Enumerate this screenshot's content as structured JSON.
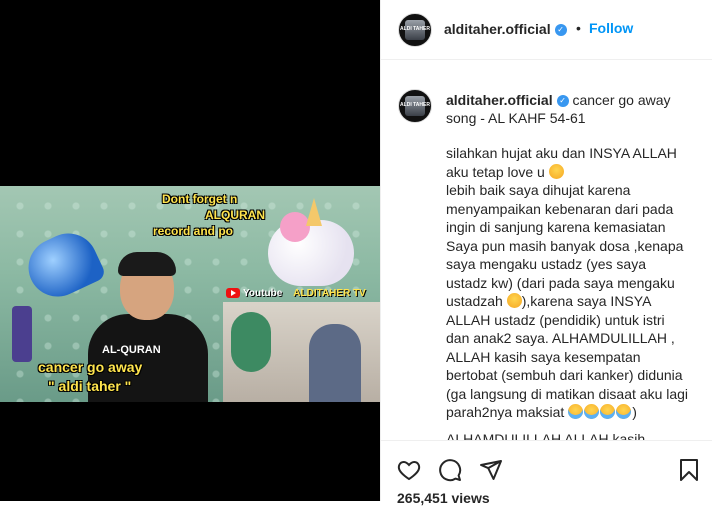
{
  "post": {
    "username": "alditaher.official",
    "follow_label": "Follow",
    "dot": "•",
    "verified_badge_icon": "verified-check-icon",
    "avatar_text": "ALDI TAHER"
  },
  "media": {
    "overlay_line1": "Dont forget n",
    "overlay_line2": "ALQURAN",
    "overlay_line3": "record and po",
    "shirt_text": "AL-QURAN",
    "caption_line1": "cancer go away",
    "caption_line2": "\" aldi taher \"",
    "youtube_word": "Youtube",
    "youtube_channel": "ALDITAHER TV"
  },
  "caption": {
    "title": "cancer go away song - AL KAHF 54-61",
    "p1a": "silahkan hujat aku dan INSYA ALLAH aku tetap love u ",
    "p1b": "lebih baik saya dihujat karena menyampaikan kebenaran dari pada ingin di sanjung karena kemasiatan Saya pun masih banyak dosa ,kenapa saya mengaku ustadz (yes saya ustadz kw) (dari pada saya mengaku ustadzah ",
    "p1c": "),karena saya INSYA ALLAH ustadz (pendidik) untuk istri dan anak2 saya. ALHAMDULILLAH , ALLAH kasih saya kesempatan bertobat (sembuh dari kanker) didunia (ga langsung di matikan disaat aku lagi parah2nya maksiat ",
    "p1d": ")",
    "cut_text": "ALHAMDULILLAH ALLAH kasih"
  },
  "actions": {
    "like_icon": "heart-icon",
    "comment_icon": "comment-icon",
    "share_icon": "share-icon",
    "save_icon": "bookmark-icon",
    "views": "265,451 views"
  },
  "colors": {
    "accent": "#0095f6",
    "verified": "#3897f0",
    "text": "#262626",
    "overlay_yellow": "#ffe44d"
  }
}
